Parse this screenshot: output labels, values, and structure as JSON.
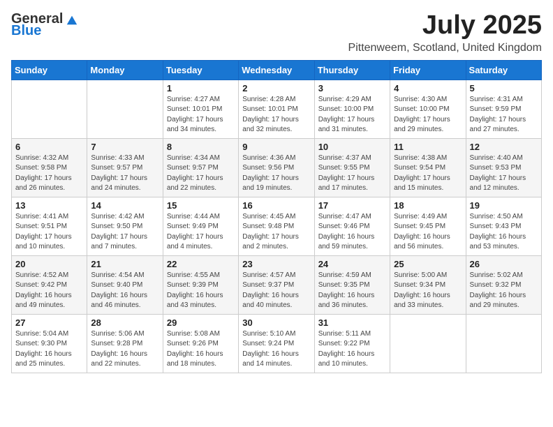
{
  "header": {
    "logo": {
      "general": "General",
      "blue": "Blue",
      "tagline": ""
    },
    "title": "July 2025",
    "subtitle": "Pittenweem, Scotland, United Kingdom"
  },
  "weekdays": [
    "Sunday",
    "Monday",
    "Tuesday",
    "Wednesday",
    "Thursday",
    "Friday",
    "Saturday"
  ],
  "weeks": [
    [
      {
        "day": "",
        "info": ""
      },
      {
        "day": "",
        "info": ""
      },
      {
        "day": "1",
        "info": "Sunrise: 4:27 AM\nSunset: 10:01 PM\nDaylight: 17 hours and 34 minutes."
      },
      {
        "day": "2",
        "info": "Sunrise: 4:28 AM\nSunset: 10:01 PM\nDaylight: 17 hours and 32 minutes."
      },
      {
        "day": "3",
        "info": "Sunrise: 4:29 AM\nSunset: 10:00 PM\nDaylight: 17 hours and 31 minutes."
      },
      {
        "day": "4",
        "info": "Sunrise: 4:30 AM\nSunset: 10:00 PM\nDaylight: 17 hours and 29 minutes."
      },
      {
        "day": "5",
        "info": "Sunrise: 4:31 AM\nSunset: 9:59 PM\nDaylight: 17 hours and 27 minutes."
      }
    ],
    [
      {
        "day": "6",
        "info": "Sunrise: 4:32 AM\nSunset: 9:58 PM\nDaylight: 17 hours and 26 minutes."
      },
      {
        "day": "7",
        "info": "Sunrise: 4:33 AM\nSunset: 9:57 PM\nDaylight: 17 hours and 24 minutes."
      },
      {
        "day": "8",
        "info": "Sunrise: 4:34 AM\nSunset: 9:57 PM\nDaylight: 17 hours and 22 minutes."
      },
      {
        "day": "9",
        "info": "Sunrise: 4:36 AM\nSunset: 9:56 PM\nDaylight: 17 hours and 19 minutes."
      },
      {
        "day": "10",
        "info": "Sunrise: 4:37 AM\nSunset: 9:55 PM\nDaylight: 17 hours and 17 minutes."
      },
      {
        "day": "11",
        "info": "Sunrise: 4:38 AM\nSunset: 9:54 PM\nDaylight: 17 hours and 15 minutes."
      },
      {
        "day": "12",
        "info": "Sunrise: 4:40 AM\nSunset: 9:53 PM\nDaylight: 17 hours and 12 minutes."
      }
    ],
    [
      {
        "day": "13",
        "info": "Sunrise: 4:41 AM\nSunset: 9:51 PM\nDaylight: 17 hours and 10 minutes."
      },
      {
        "day": "14",
        "info": "Sunrise: 4:42 AM\nSunset: 9:50 PM\nDaylight: 17 hours and 7 minutes."
      },
      {
        "day": "15",
        "info": "Sunrise: 4:44 AM\nSunset: 9:49 PM\nDaylight: 17 hours and 4 minutes."
      },
      {
        "day": "16",
        "info": "Sunrise: 4:45 AM\nSunset: 9:48 PM\nDaylight: 17 hours and 2 minutes."
      },
      {
        "day": "17",
        "info": "Sunrise: 4:47 AM\nSunset: 9:46 PM\nDaylight: 16 hours and 59 minutes."
      },
      {
        "day": "18",
        "info": "Sunrise: 4:49 AM\nSunset: 9:45 PM\nDaylight: 16 hours and 56 minutes."
      },
      {
        "day": "19",
        "info": "Sunrise: 4:50 AM\nSunset: 9:43 PM\nDaylight: 16 hours and 53 minutes."
      }
    ],
    [
      {
        "day": "20",
        "info": "Sunrise: 4:52 AM\nSunset: 9:42 PM\nDaylight: 16 hours and 49 minutes."
      },
      {
        "day": "21",
        "info": "Sunrise: 4:54 AM\nSunset: 9:40 PM\nDaylight: 16 hours and 46 minutes."
      },
      {
        "day": "22",
        "info": "Sunrise: 4:55 AM\nSunset: 9:39 PM\nDaylight: 16 hours and 43 minutes."
      },
      {
        "day": "23",
        "info": "Sunrise: 4:57 AM\nSunset: 9:37 PM\nDaylight: 16 hours and 40 minutes."
      },
      {
        "day": "24",
        "info": "Sunrise: 4:59 AM\nSunset: 9:35 PM\nDaylight: 16 hours and 36 minutes."
      },
      {
        "day": "25",
        "info": "Sunrise: 5:00 AM\nSunset: 9:34 PM\nDaylight: 16 hours and 33 minutes."
      },
      {
        "day": "26",
        "info": "Sunrise: 5:02 AM\nSunset: 9:32 PM\nDaylight: 16 hours and 29 minutes."
      }
    ],
    [
      {
        "day": "27",
        "info": "Sunrise: 5:04 AM\nSunset: 9:30 PM\nDaylight: 16 hours and 25 minutes."
      },
      {
        "day": "28",
        "info": "Sunrise: 5:06 AM\nSunset: 9:28 PM\nDaylight: 16 hours and 22 minutes."
      },
      {
        "day": "29",
        "info": "Sunrise: 5:08 AM\nSunset: 9:26 PM\nDaylight: 16 hours and 18 minutes."
      },
      {
        "day": "30",
        "info": "Sunrise: 5:10 AM\nSunset: 9:24 PM\nDaylight: 16 hours and 14 minutes."
      },
      {
        "day": "31",
        "info": "Sunrise: 5:11 AM\nSunset: 9:22 PM\nDaylight: 16 hours and 10 minutes."
      },
      {
        "day": "",
        "info": ""
      },
      {
        "day": "",
        "info": ""
      }
    ]
  ]
}
